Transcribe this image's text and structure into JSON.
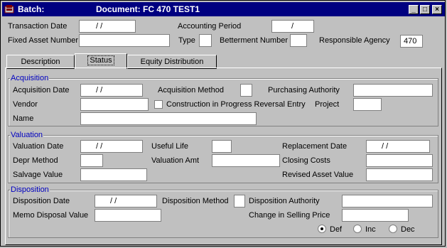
{
  "window": {
    "title_label": "Batch:",
    "document_label": "Document: FC   470  TEST1",
    "controls": {
      "minimize": "_",
      "maximize": "□",
      "close": "×"
    }
  },
  "header": {
    "transaction_date_label": "Transaction Date",
    "transaction_date_value": "/   /",
    "accounting_period_label": "Accounting Period",
    "accounting_period_value": "/",
    "fixed_asset_number_label": "Fixed Asset Number",
    "type_label": "Type",
    "betterment_number_label": "Betterment Number",
    "responsible_agency_label": "Responsible Agency",
    "responsible_agency_value": "470"
  },
  "tabs": [
    {
      "label": "Description"
    },
    {
      "label": "Status"
    },
    {
      "label": "Equity Distribution"
    }
  ],
  "acquisition": {
    "title": "Acquisition",
    "acquisition_date_label": "Acquisition Date",
    "acquisition_date_value": "/   /",
    "acquisition_method_label": "Acquisition Method",
    "purchasing_authority_label": "Purchasing Authority",
    "vendor_label": "Vendor",
    "construction_label": "Construction in Progress Reversal Entry",
    "project_label": "Project",
    "name_label": "Name"
  },
  "valuation": {
    "title": "Valuation",
    "valuation_date_label": "Valuation Date",
    "valuation_date_value": "/   /",
    "useful_life_label": "Useful Life",
    "replacement_date_label": "Replacement Date",
    "replacement_date_value": "/   /",
    "depr_method_label": "Depr Method",
    "valuation_amt_label": "Valuation Amt",
    "closing_costs_label": "Closing Costs",
    "salvage_value_label": "Salvage Value",
    "revised_asset_value_label": "Revised Asset Value"
  },
  "disposition": {
    "title": "Disposition",
    "disposition_date_label": "Disposition Date",
    "disposition_date_value": "/   /",
    "disposition_method_label": "Disposition Method",
    "disposition_authority_label": "Disposition Authority",
    "memo_disposal_value_label": "Memo Disposal Value",
    "change_in_selling_price_label": "Change in Selling Price",
    "radios": [
      {
        "label": "Def",
        "selected": true
      },
      {
        "label": "Inc",
        "selected": false
      },
      {
        "label": "Dec",
        "selected": false
      }
    ]
  },
  "colors": {
    "title_bar": "#000080",
    "group_title": "#0000c0",
    "window_bg": "#c0c0c0"
  }
}
